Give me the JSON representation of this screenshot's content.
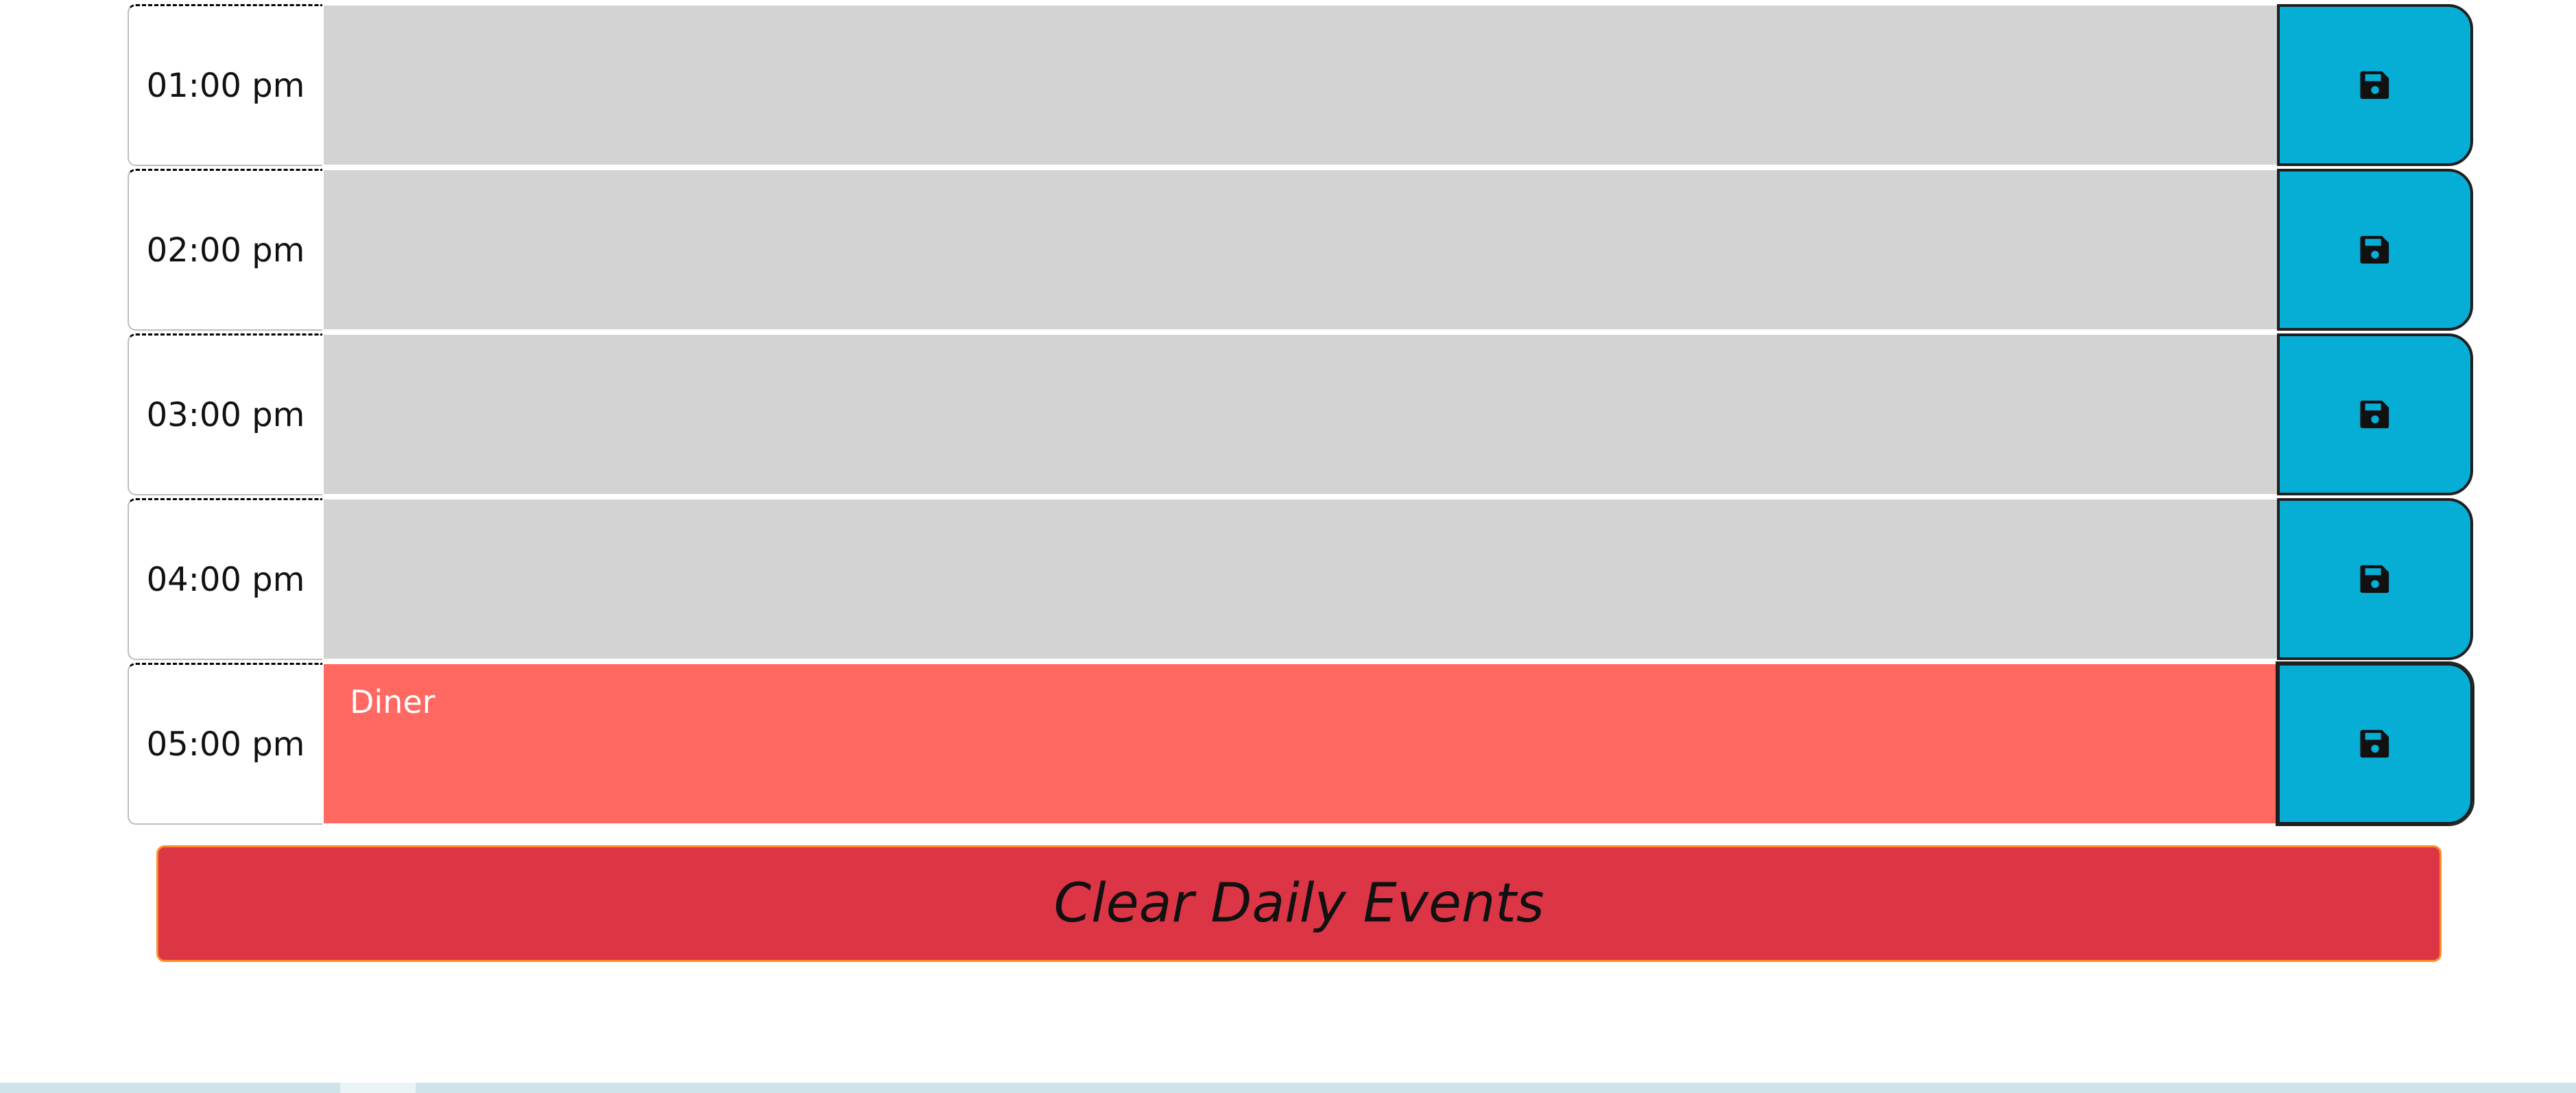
{
  "timeblocks": [
    {
      "hour": "01:00 pm",
      "event": "",
      "state": "past"
    },
    {
      "hour": "02:00 pm",
      "event": "",
      "state": "past"
    },
    {
      "hour": "03:00 pm",
      "event": "",
      "state": "past"
    },
    {
      "hour": "04:00 pm",
      "event": "",
      "state": "past"
    },
    {
      "hour": "05:00 pm",
      "event": "Diner",
      "state": "present"
    }
  ],
  "save_icon": "floppy-disk-icon",
  "clear_button": {
    "label": "Clear Daily Events"
  },
  "colors": {
    "past": "#d3d3d3",
    "present": "#ff6961",
    "save_button": "#06aed5",
    "clear_button": "#dc3545"
  }
}
